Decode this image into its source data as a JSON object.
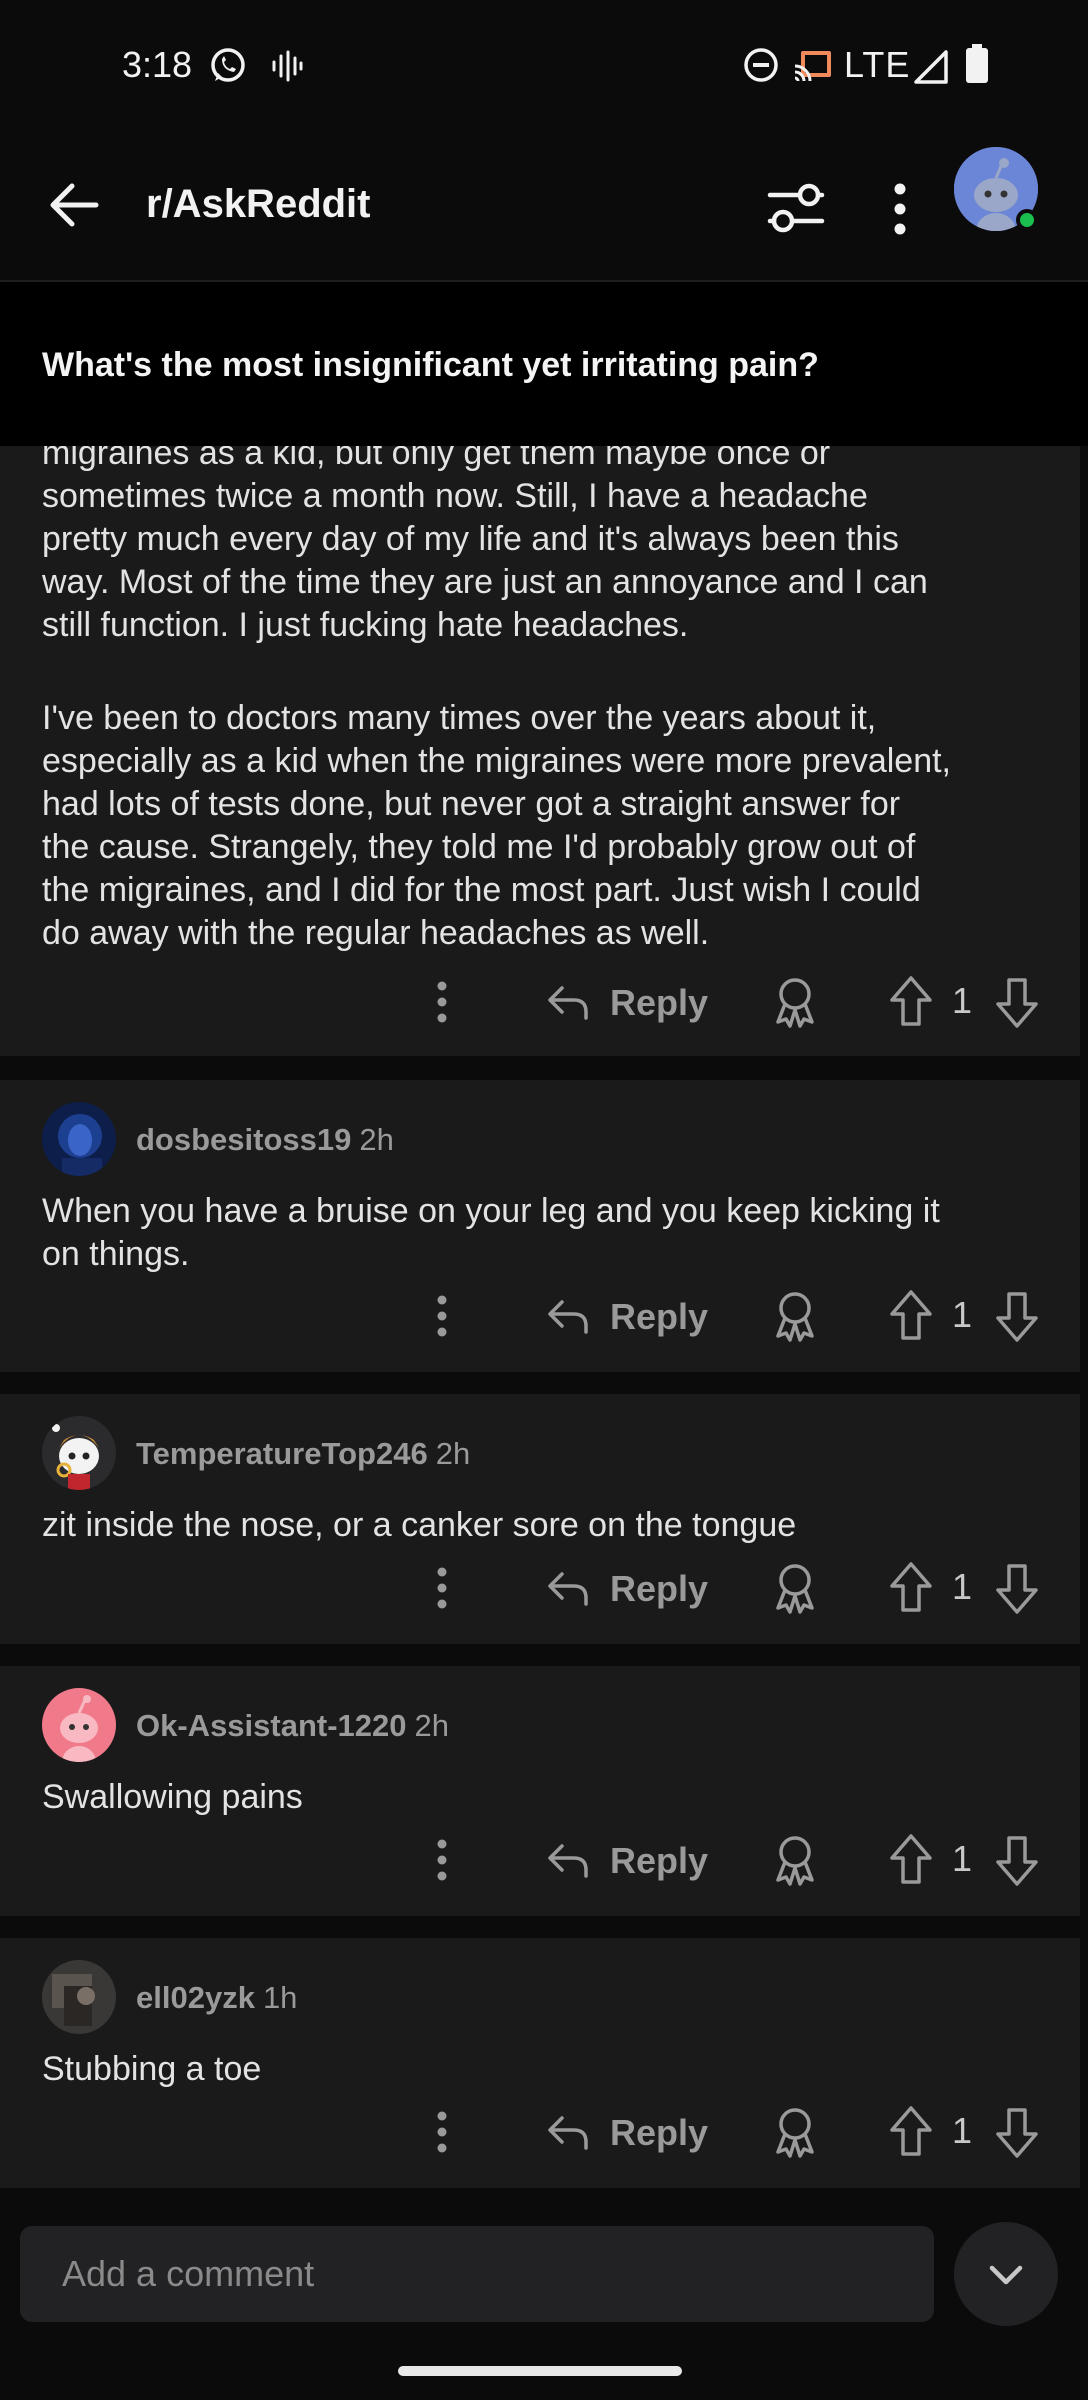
{
  "status_bar": {
    "time": "3:18",
    "network": "LTE",
    "icons": [
      "whatsapp-icon",
      "voice-waveform-icon",
      "do-not-disturb-icon",
      "cast-icon",
      "signal-icon",
      "battery-icon"
    ]
  },
  "header": {
    "subreddit": "r/AskReddit",
    "icons": [
      "back-arrow-icon",
      "filter-icon",
      "more-vertical-icon",
      "avatar"
    ]
  },
  "post": {
    "title": "What's the most insignificant yet irritating pain?"
  },
  "comments": [
    {
      "username": "",
      "time": "",
      "lines": [
        "migraines as a kid, but only get them maybe once or",
        "sometimes twice a month now.  Still, I have a headache",
        "pretty much every day of my life and it's always been this",
        "way.  Most of the time they are just an annoyance and I can",
        "still function.  I just fucking hate headaches.",
        "",
        "I've been to doctors many times over the years about it,",
        "especially as a kid when the migraines were more prevalent,",
        "had lots of tests done, but never got a straight answer for",
        "the cause.  Strangely, they told me I'd probably grow out of",
        "the migraines, and I did for the most part.  Just wish I could",
        "do away with the regular headaches as well."
      ],
      "reply_label": "Reply",
      "votes": "1"
    },
    {
      "username": "dosbesitoss19",
      "time": "2h",
      "lines": [
        "When you have a bruise on your leg and you keep kicking it",
        "on things."
      ],
      "reply_label": "Reply",
      "votes": "1"
    },
    {
      "username": "TemperatureTop246",
      "time": "2h",
      "lines": [
        "zit inside the nose, or a canker sore on the tongue"
      ],
      "reply_label": "Reply",
      "votes": "1"
    },
    {
      "username": "Ok-Assistant-1220",
      "time": "2h",
      "lines": [
        "Swallowing pains"
      ],
      "reply_label": "Reply",
      "votes": "1"
    },
    {
      "username": "ell02yzk",
      "time": "1h",
      "lines": [
        "Stubbing a toe"
      ],
      "reply_label": "Reply",
      "votes": "1"
    }
  ],
  "bottom": {
    "comment_placeholder": "Add a comment",
    "jump_icon": "chevron-down-icon"
  },
  "colors": {
    "background": "#0b0b0b",
    "card": "#1a1a1b",
    "muted_text": "#9a9a9a",
    "online": "#1bbf4f"
  }
}
